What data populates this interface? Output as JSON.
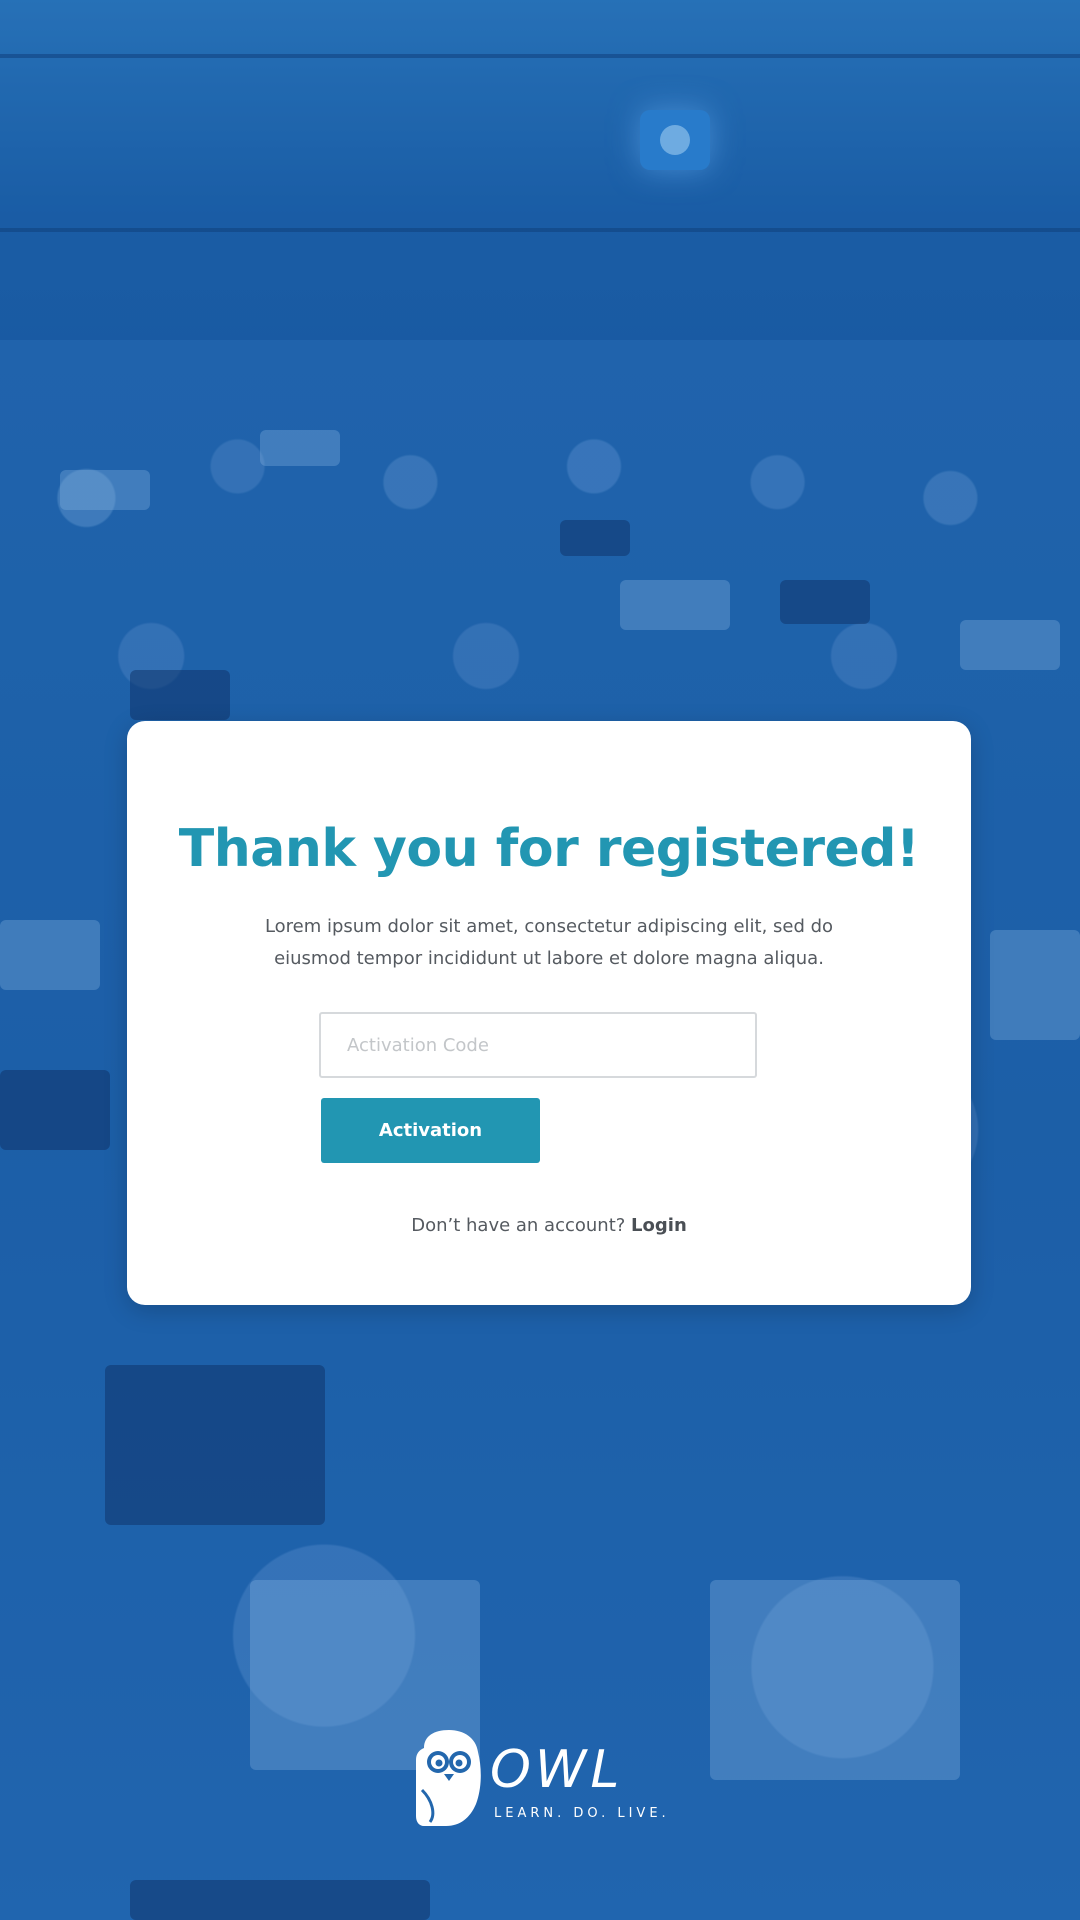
{
  "card": {
    "title": "Thank you for registered!",
    "description": "Lorem ipsum dolor sit amet, consectetur adipiscing elit, sed do eiusmod tempor incididunt ut labore et dolore magna aliqua.",
    "activation_input": {
      "value": "",
      "placeholder": "Activation Code"
    },
    "activation_button_label": "Activation",
    "footer_prompt": "Don’t have an account?",
    "footer_link_label": "Login"
  },
  "brand": {
    "logo_icon": "owl-icon",
    "name": "OWL",
    "tagline": "LEARN. DO. LIVE.",
    "accent_color": "#2296b2"
  }
}
